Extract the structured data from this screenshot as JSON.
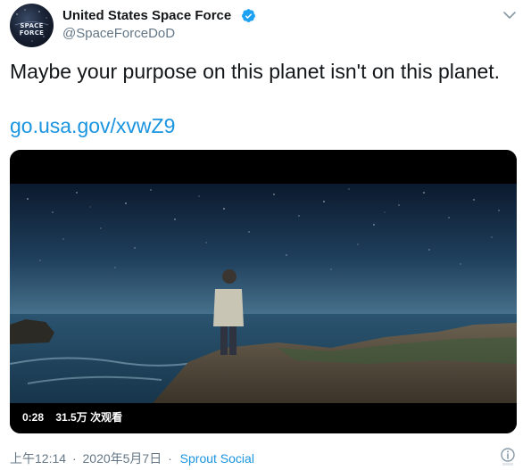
{
  "user": {
    "display_name": "United States Space Force",
    "handle": "@SpaceForceDoD",
    "avatar_text": "SPACE FORCE",
    "verified_color": "#1da1f2"
  },
  "tweet": {
    "text": "Maybe your purpose on this planet isn't on this planet.",
    "link": "go.usa.gov/xvwZ9"
  },
  "video": {
    "duration": "0:28",
    "views": "31.5万 次观看"
  },
  "footer": {
    "time": "上午12:14",
    "separator": "·",
    "date": "2020年5月7日",
    "source": "Sprout Social"
  },
  "icons": {
    "menu": "chevron-down-icon",
    "verified": "verified-badge-icon",
    "info": "info-icon"
  },
  "colors": {
    "link": "#1b95e0",
    "secondary_text": "#657786",
    "primary_text": "#14171a"
  }
}
